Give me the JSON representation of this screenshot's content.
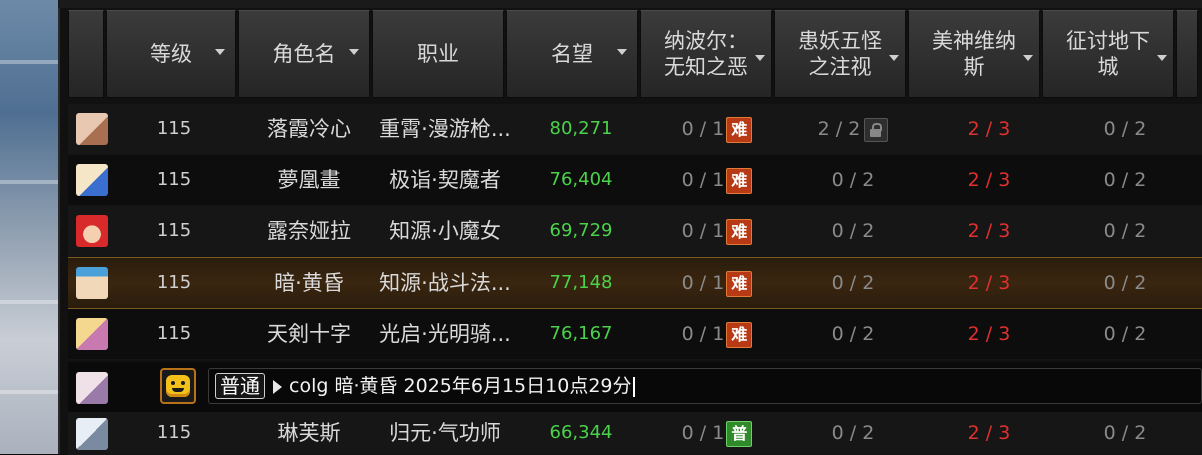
{
  "header": {
    "columns": [
      {
        "label": "",
        "sort": false
      },
      {
        "label": "等级",
        "sort": true
      },
      {
        "label": "角色名",
        "sort": true
      },
      {
        "label": "职业",
        "sort": false
      },
      {
        "label": "名望",
        "sort": true
      },
      {
        "label": "纳波尔：\n无知之恶",
        "sort": true
      },
      {
        "label": "患妖五怪\n之注视",
        "sort": true
      },
      {
        "label": "美神维纳\n斯",
        "sort": true
      },
      {
        "label": "征讨地下\n城",
        "sort": true
      }
    ]
  },
  "rows": [
    {
      "level": "115",
      "name": "落霞冷心",
      "job": "重霄·漫游枪...",
      "fame": "80,271",
      "d1": "0 / 1",
      "d1_badge": "难",
      "d2": "2 / 2",
      "d2_lock": true,
      "d3": "2 / 3",
      "d4": "0 / 2",
      "avatar_colors": [
        "#e8c8b0",
        "#a87050"
      ]
    },
    {
      "level": "115",
      "name": "夢凰畫",
      "job": "极诣·契魔者",
      "fame": "76,404",
      "d1": "0 / 1",
      "d1_badge": "难",
      "d2": "0 / 2",
      "d2_lock": false,
      "d3": "2 / 3",
      "d4": "0 / 2",
      "avatar_colors": [
        "#f5e6c8",
        "#3a6fd0"
      ]
    },
    {
      "level": "115",
      "name": "露奈娅拉",
      "job": "知源·小魔女",
      "fame": "69,729",
      "d1": "0 / 1",
      "d1_badge": "难",
      "d2": "0 / 2",
      "d2_lock": false,
      "d3": "2 / 3",
      "d4": "0 / 2",
      "avatar_colors": [
        "#d82a2a",
        "#f5d0b0"
      ]
    },
    {
      "level": "115",
      "name": "暗·黄昏",
      "job": "知源·战斗法...",
      "fame": "77,148",
      "d1": "0 / 1",
      "d1_badge": "难",
      "d2": "0 / 2",
      "d2_lock": false,
      "d3": "2 / 3",
      "d4": "0 / 2",
      "avatar_colors": [
        "#f0d8b8",
        "#4aa0d8"
      ]
    },
    {
      "level": "115",
      "name": "天剣十字",
      "job": "光启·光明骑...",
      "fame": "76,167",
      "d1": "0 / 1",
      "d1_badge": "难",
      "d2": "0 / 2",
      "d2_lock": false,
      "d3": "2 / 3",
      "d4": "0 / 2",
      "avatar_colors": [
        "#f5d890",
        "#c87ab0"
      ]
    }
  ],
  "chat": {
    "channel": "普通",
    "text": "colg 暗·黄昏 2025年6月15日10点29分"
  },
  "last_row": {
    "level": "115",
    "name": "琳芙斯",
    "job": "归元·气功师",
    "fame": "66,344",
    "d1": "0 / 1",
    "d1_badge": "普",
    "d2": "0 / 2",
    "d3": "2 / 3",
    "d4": "0 / 2",
    "avatar_colors": [
      "#e8eef5",
      "#7a8aa0"
    ]
  },
  "colors": {
    "fame": "#4ad34a",
    "weekly_red": "#e03030",
    "hard_badge": "#b83a14",
    "normal_badge": "#2f8a2a",
    "selected_row": "#3a2610"
  }
}
